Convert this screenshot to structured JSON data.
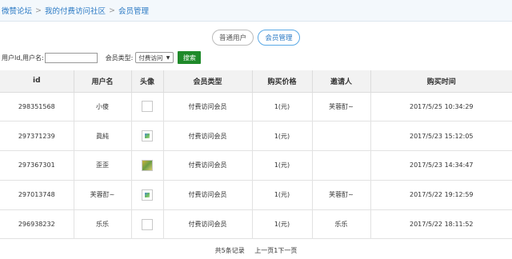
{
  "breadcrumb": {
    "items": [
      "微赞论坛",
      "我的付费访问社区",
      "会员管理"
    ],
    "separator": ">"
  },
  "tabs": [
    {
      "label": "普通用户",
      "active": false
    },
    {
      "label": "会员管理",
      "active": true
    }
  ],
  "filter": {
    "id_label": "用户Id,用户名:",
    "id_value": "",
    "type_label": "会员类型:",
    "type_selected": "付费访问",
    "search_label": "搜索"
  },
  "table": {
    "columns": [
      "id",
      "用户名",
      "头像",
      "会员类型",
      "购买价格",
      "邀请人",
      "购买时间"
    ],
    "rows": [
      {
        "id": "298351568",
        "username": "小傻",
        "avatar": "blank-avatar",
        "type": "付费访问会员",
        "price": "1(元)",
        "inviter": "芙蓉酊~",
        "time": "2017/5/25 10:34:29"
      },
      {
        "id": "297371239",
        "username": "眞純",
        "avatar": "broken-image-icon",
        "type": "付费访问会员",
        "price": "1(元)",
        "inviter": "",
        "time": "2017/5/23 15:12:05"
      },
      {
        "id": "297367301",
        "username": "歪歪",
        "avatar": "photo-avatar",
        "type": "付费访问会员",
        "price": "1(元)",
        "inviter": "",
        "time": "2017/5/23 14:34:47"
      },
      {
        "id": "297013748",
        "username": "芙蓉酊~",
        "avatar": "broken-image-icon",
        "type": "付费访问会员",
        "price": "1(元)",
        "inviter": "芙蓉酊~",
        "time": "2017/5/22 19:12:59"
      },
      {
        "id": "296938232",
        "username": "乐乐",
        "avatar": "blank-avatar",
        "type": "付费访问会员",
        "price": "1(元)",
        "inviter": "乐乐",
        "time": "2017/5/22 18:11:52"
      }
    ]
  },
  "pager": {
    "total": "共5条记录",
    "pages": "上一页1下一页"
  },
  "colors": {
    "link": "#2a79c4",
    "search_button": "#1f8a2a",
    "active_tab_border": "#5aa9e6",
    "header_bg": "#f2f2f2"
  }
}
